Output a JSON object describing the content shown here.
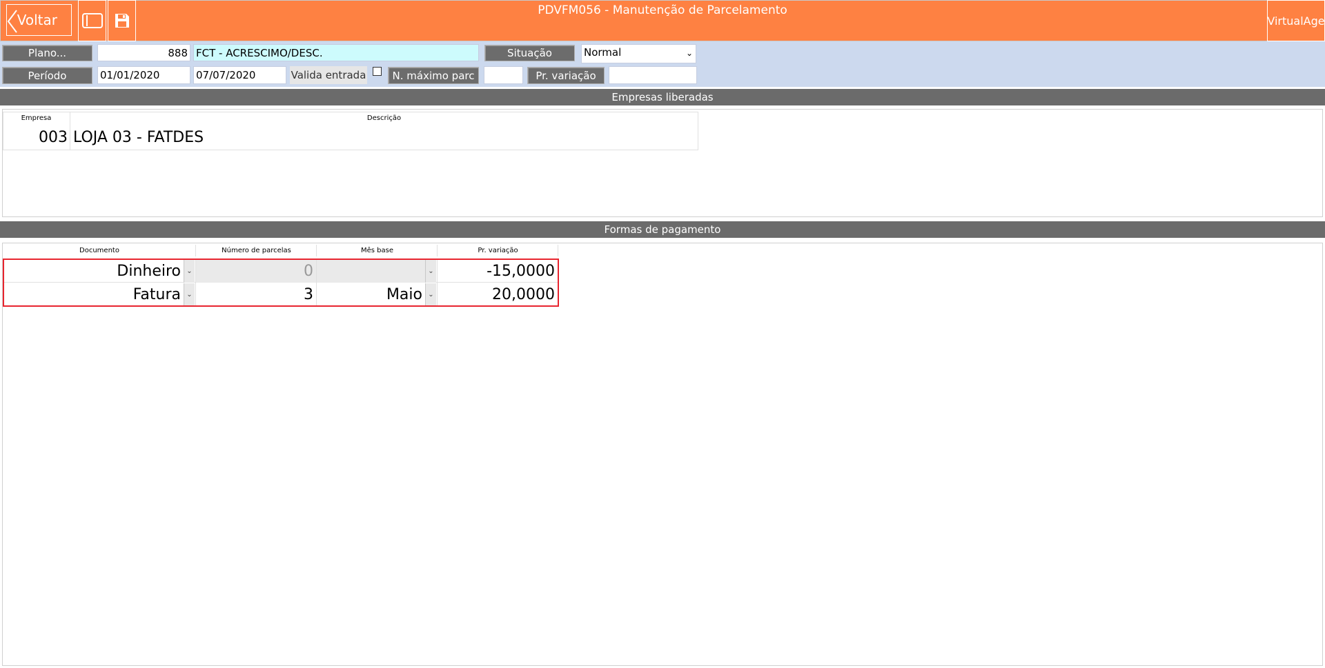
{
  "header": {
    "back_label": "Voltar",
    "title": "PDVFM056 - Manutenção de Parcelamento",
    "brand": "VirtualAge",
    "accent": "#fe8142"
  },
  "filters": {
    "plano_label": "Plano...",
    "plano_code": "888",
    "plano_desc": "FCT - ACRESCIMO/DESC.",
    "situacao_label": "Situação",
    "situacao_value": "Normal",
    "periodo_label": "Período",
    "periodo_inicio": "01/01/2020",
    "periodo_fim": "07/07/2020",
    "valida_entrada_label": "Valida entrada",
    "n_maximo_label": "N. máximo parc",
    "n_maximo_value": "",
    "pr_variacao_label": "Pr. variação",
    "pr_variacao_value": ""
  },
  "empresas": {
    "section_title": "Empresas liberadas",
    "columns": [
      "Empresa",
      "Descrição"
    ],
    "rows": [
      {
        "empresa": "003",
        "descricao": "LOJA 03 - FATDES"
      }
    ]
  },
  "formas": {
    "section_title": "Formas de pagamento",
    "columns": [
      "Documento",
      "Número de parcelas",
      "Mês base",
      "Pr. variação"
    ],
    "rows": [
      {
        "documento": "Dinheiro",
        "parcelas": "0",
        "mes_base": "",
        "variacao": "-15,0000"
      },
      {
        "documento": "Fatura",
        "parcelas": "3",
        "mes_base": "Maio",
        "variacao": "20,0000"
      }
    ]
  }
}
